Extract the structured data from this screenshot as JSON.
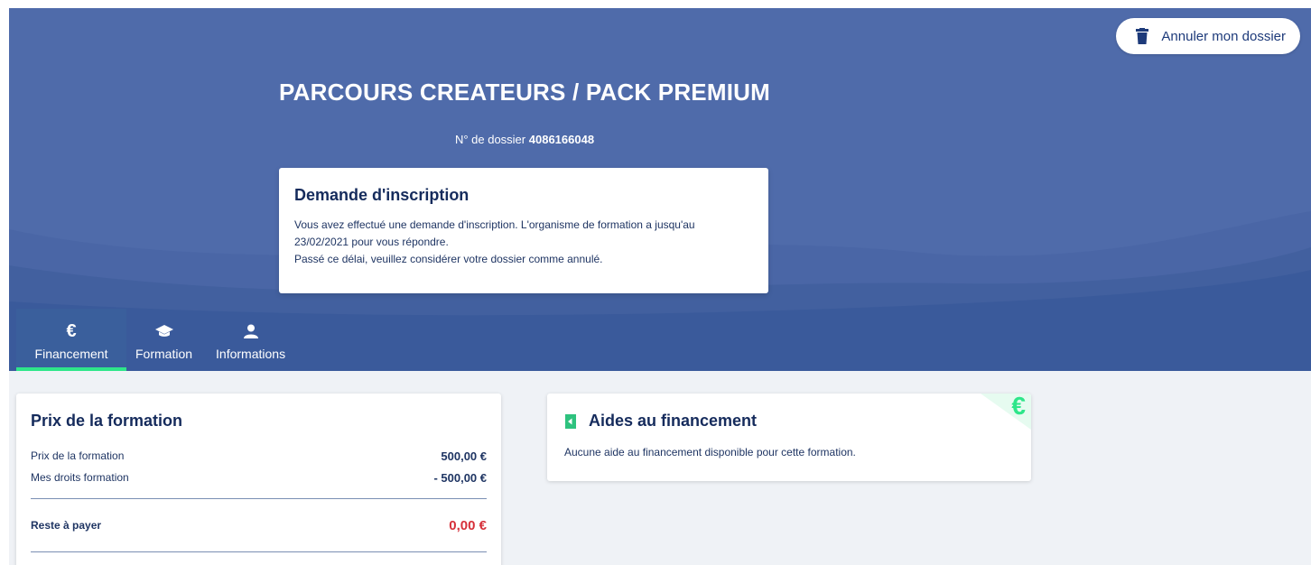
{
  "header": {
    "cancel_button": "Annuler mon dossier",
    "title": "PARCOURS CREATEURS / PACK PREMIUM",
    "dossier_label": "N° de dossier",
    "dossier_number": "4086166048"
  },
  "notice": {
    "title": "Demande d'inscription",
    "line1": "Vous avez effectué une demande d'inscription. L'organisme de formation a jusqu'au",
    "line2": "23/02/2021 pour vous répondre.",
    "line3": "Passé ce délai, veuillez considérer votre dossier comme annulé."
  },
  "tabs": [
    {
      "label": "Financement",
      "icon": "euro-icon",
      "active": true
    },
    {
      "label": "Formation",
      "icon": "graduation-cap-icon",
      "active": false
    },
    {
      "label": "Informations",
      "icon": "user-icon",
      "active": false
    }
  ],
  "price_card": {
    "title": "Prix de la formation",
    "rows": [
      {
        "label": "Prix de la formation",
        "amount": "500,00 €"
      },
      {
        "label": "Mes droits formation",
        "amount": "- 500,00 €"
      }
    ],
    "total_label": "Reste à payer",
    "total_amount": "0,00 €"
  },
  "aides_card": {
    "title": "Aides au financement",
    "text": "Aucune aide au financement disponible pour cette formation.",
    "corner_symbol": "€"
  },
  "colors": {
    "header_blue": "#4f6baa",
    "active_tab": "#3a5f9c",
    "accent_green": "#2ee68a",
    "total_red": "#d6303a",
    "text_navy": "#152b5c"
  }
}
